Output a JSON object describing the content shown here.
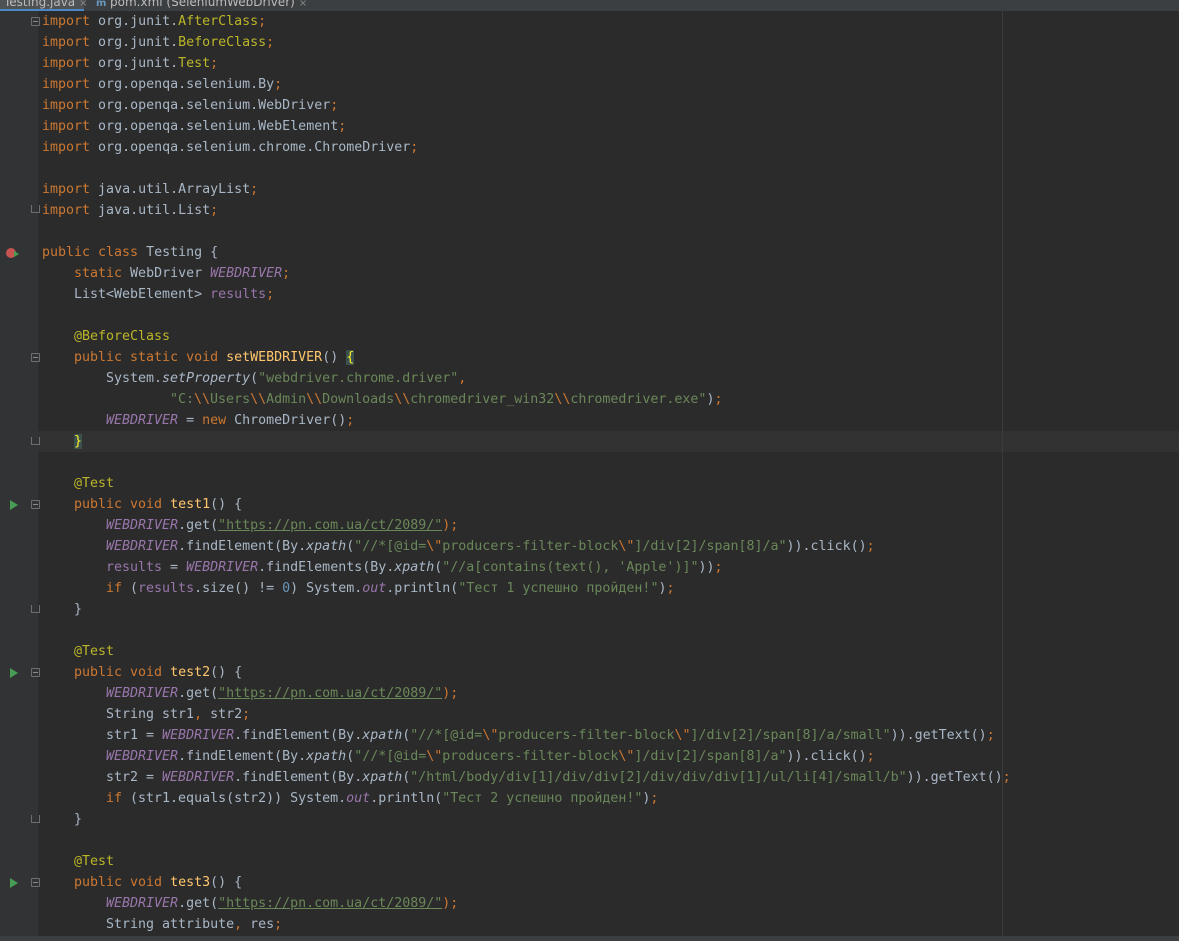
{
  "tabs": [
    {
      "label": "Testing.java",
      "close": "×",
      "active": true
    },
    {
      "label": "pom.xml (SeleniumWebDriver)",
      "close": "×",
      "icon": "m",
      "active": false
    }
  ],
  "colors": {
    "background": "#2b2b2b",
    "keyword": "#cc7832",
    "annotation": "#bbb529",
    "string": "#6a8759",
    "field": "#9876aa",
    "method": "#ffc66d",
    "number": "#6897bb",
    "default": "#a9b7c6"
  },
  "code": {
    "imports": [
      {
        "kw": "import",
        "pkg": " org.junit.",
        "cls": "AfterClass",
        "end": ";"
      },
      {
        "kw": "import",
        "pkg": " org.junit.",
        "cls": "BeforeClass",
        "end": ";"
      },
      {
        "kw": "import",
        "pkg": " org.junit.",
        "cls": "Test",
        "end": ";"
      },
      {
        "kw": "import",
        "pkg": " org.openqa.selenium.By",
        "cls": "",
        "end": ";"
      },
      {
        "kw": "import",
        "pkg": " org.openqa.selenium.WebDriver",
        "cls": "",
        "end": ";"
      },
      {
        "kw": "import",
        "pkg": " org.openqa.selenium.WebElement",
        "cls": "",
        "end": ";"
      },
      {
        "kw": "import",
        "pkg": " org.openqa.selenium.chrome.ChromeDriver",
        "cls": "",
        "end": ";"
      },
      {
        "kw": "import",
        "pkg": " java.util.ArrayList",
        "cls": "",
        "end": ";"
      },
      {
        "kw": "import",
        "pkg": " java.util.List",
        "cls": "",
        "end": ";"
      }
    ],
    "class_decl": {
      "kw": "public class",
      "name": " Testing {"
    },
    "field1": {
      "kw": "static",
      "type": " WebDriver ",
      "name": "WEBDRIVER",
      "end": ";"
    },
    "field2": {
      "type": "List<WebElement> ",
      "name": "results",
      "end": ";"
    },
    "before_annotation": "@BeforeClass",
    "setup_decl": {
      "kw": "public static void",
      "name": " setWEBDRIVER",
      "rest": "() ",
      "brace": "{"
    },
    "setup_line1": {
      "pre": "System.",
      "call": "setProperty",
      "open": "(",
      "str": "\"webdriver.chrome.driver\"",
      "end": ","
    },
    "setup_line2": {
      "parts": [
        {
          "t": "\"C:",
          "c": "str"
        },
        {
          "t": "\\\\",
          "c": "esc"
        },
        {
          "t": "Users",
          "c": "str"
        },
        {
          "t": "\\\\",
          "c": "esc"
        },
        {
          "t": "Admin",
          "c": "str"
        },
        {
          "t": "\\\\",
          "c": "esc"
        },
        {
          "t": "Downloads",
          "c": "str"
        },
        {
          "t": "\\\\",
          "c": "esc"
        },
        {
          "t": "chromedriver_win32",
          "c": "str"
        },
        {
          "t": "\\\\",
          "c": "esc"
        },
        {
          "t": "chromedriver.exe\"",
          "c": "str"
        },
        {
          "t": ")",
          "c": "def"
        },
        {
          "t": ";",
          "c": "kw"
        }
      ]
    },
    "setup_line3": {
      "field": "WEBDRIVER",
      "mid": " = ",
      "kw": "new",
      "rest": " ChromeDriver()",
      "end": ";"
    },
    "closing_brace": "}",
    "test_annotation": "@Test",
    "test1": {
      "decl": {
        "kw": "public void",
        "name": " test1",
        "rest": "() {"
      },
      "l1": {
        "field": "WEBDRIVER",
        "mid": ".get(",
        "url": "\"https://pn.com.ua/ct/2089/\"",
        "end": ");"
      },
      "l2": {
        "parts": [
          {
            "t": "WEBDRIVER",
            "c": "field"
          },
          {
            "t": ".findElement(By.",
            "c": "def"
          },
          {
            "t": "xpath",
            "c": "static"
          },
          {
            "t": "(",
            "c": "def"
          },
          {
            "t": "\"//*[@id=",
            "c": "str"
          },
          {
            "t": "\\\"",
            "c": "esc"
          },
          {
            "t": "producers-filter-block",
            "c": "str"
          },
          {
            "t": "\\\"",
            "c": "esc"
          },
          {
            "t": "]/div[2]/span[8]/a\"",
            "c": "str"
          },
          {
            "t": ")).click()",
            "c": "def"
          },
          {
            "t": ";",
            "c": "kw"
          }
        ]
      },
      "l3": {
        "parts": [
          {
            "t": "results",
            "c": "inst"
          },
          {
            "t": " = ",
            "c": "def"
          },
          {
            "t": "WEBDRIVER",
            "c": "field"
          },
          {
            "t": ".findElements(By.",
            "c": "def"
          },
          {
            "t": "xpath",
            "c": "static"
          },
          {
            "t": "(",
            "c": "def"
          },
          {
            "t": "\"//a[contains(text(), 'Apple')]\"",
            "c": "str"
          },
          {
            "t": "))",
            "c": "def"
          },
          {
            "t": ";",
            "c": "kw"
          }
        ]
      },
      "l4": {
        "parts": [
          {
            "t": "if",
            "c": "kw"
          },
          {
            "t": " (",
            "c": "def"
          },
          {
            "t": "results",
            "c": "inst"
          },
          {
            "t": ".size() != ",
            "c": "def"
          },
          {
            "t": "0",
            "c": "num"
          },
          {
            "t": ") System.",
            "c": "def"
          },
          {
            "t": "out",
            "c": "field"
          },
          {
            "t": ".println(",
            "c": "def"
          },
          {
            "t": "\"Тест 1 успешно пройден!\"",
            "c": "str"
          },
          {
            "t": ")",
            "c": "def"
          },
          {
            "t": ";",
            "c": "kw"
          }
        ]
      }
    },
    "test2": {
      "decl": {
        "kw": "public void",
        "name": " test2",
        "rest": "() {"
      },
      "l1": {
        "field": "WEBDRIVER",
        "mid": ".get(",
        "url": "\"https://pn.com.ua/ct/2089/\"",
        "end": ");"
      },
      "l2": {
        "parts": [
          {
            "t": "String str1",
            "c": "def"
          },
          {
            "t": ",",
            "c": "kw"
          },
          {
            "t": " str2",
            "c": "def"
          },
          {
            "t": ";",
            "c": "kw"
          }
        ]
      },
      "l3": {
        "parts": [
          {
            "t": "str1 = ",
            "c": "def"
          },
          {
            "t": "WEBDRIVER",
            "c": "field"
          },
          {
            "t": ".findElement(By.",
            "c": "def"
          },
          {
            "t": "xpath",
            "c": "static"
          },
          {
            "t": "(",
            "c": "def"
          },
          {
            "t": "\"//*[@id=",
            "c": "str"
          },
          {
            "t": "\\\"",
            "c": "esc"
          },
          {
            "t": "producers-filter-block",
            "c": "str"
          },
          {
            "t": "\\\"",
            "c": "esc"
          },
          {
            "t": "]/div[2]/span[8]/a/small\"",
            "c": "str"
          },
          {
            "t": ")).getText()",
            "c": "def"
          },
          {
            "t": ";",
            "c": "kw"
          }
        ]
      },
      "l4": {
        "parts": [
          {
            "t": "WEBDRIVER",
            "c": "field"
          },
          {
            "t": ".findElement(By.",
            "c": "def"
          },
          {
            "t": "xpath",
            "c": "static"
          },
          {
            "t": "(",
            "c": "def"
          },
          {
            "t": "\"//*[@id=",
            "c": "str"
          },
          {
            "t": "\\\"",
            "c": "esc"
          },
          {
            "t": "producers-filter-block",
            "c": "str"
          },
          {
            "t": "\\\"",
            "c": "esc"
          },
          {
            "t": "]/div[2]/span[8]/a\"",
            "c": "str"
          },
          {
            "t": ")).click()",
            "c": "def"
          },
          {
            "t": ";",
            "c": "kw"
          }
        ]
      },
      "l5": {
        "parts": [
          {
            "t": "str2 = ",
            "c": "def"
          },
          {
            "t": "WEBDRIVER",
            "c": "field"
          },
          {
            "t": ".findElement(By.",
            "c": "def"
          },
          {
            "t": "xpath",
            "c": "static"
          },
          {
            "t": "(",
            "c": "def"
          },
          {
            "t": "\"/html/body/div[1]/div/div[2]/div/div/div[1]/ul/li[4]/small/b\"",
            "c": "str"
          },
          {
            "t": ")).getText()",
            "c": "def"
          },
          {
            "t": ";",
            "c": "kw"
          }
        ]
      },
      "l6": {
        "parts": [
          {
            "t": "if",
            "c": "kw"
          },
          {
            "t": " (str1.equals(str2)) System.",
            "c": "def"
          },
          {
            "t": "out",
            "c": "field"
          },
          {
            "t": ".println(",
            "c": "def"
          },
          {
            "t": "\"Тест 2 успешно пройден!\"",
            "c": "str"
          },
          {
            "t": ")",
            "c": "def"
          },
          {
            "t": ";",
            "c": "kw"
          }
        ]
      }
    },
    "test3": {
      "decl": {
        "kw": "public void",
        "name": " test3",
        "rest": "() {"
      },
      "l1": {
        "field": "WEBDRIVER",
        "mid": ".get(",
        "url": "\"https://pn.com.ua/ct/2089/\"",
        "end": ");"
      },
      "l2": {
        "parts": [
          {
            "t": "String attribute",
            "c": "def"
          },
          {
            "t": ",",
            "c": "kw"
          },
          {
            "t": " res",
            "c": "def"
          },
          {
            "t": ";",
            "c": "kw"
          }
        ]
      }
    }
  }
}
